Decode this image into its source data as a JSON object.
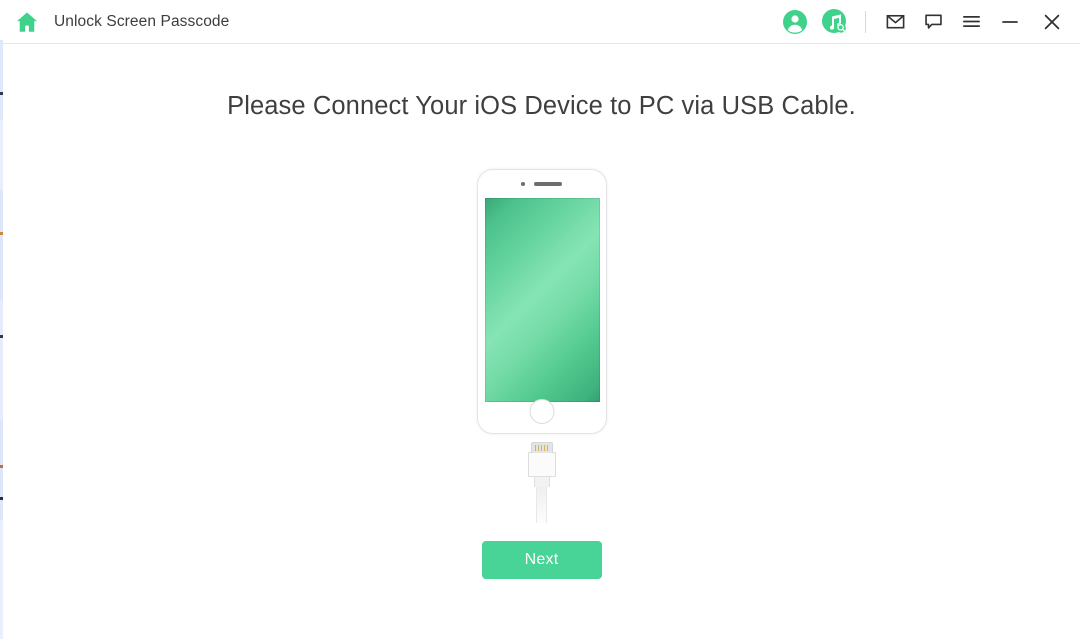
{
  "window": {
    "title": "Unlock Screen Passcode",
    "home_icon": "home-icon",
    "accent_color": "#48d397",
    "title_color": "#3d3d3d"
  },
  "titlebar_actions": [
    {
      "name": "account-icon",
      "label": "Account"
    },
    {
      "name": "music-search-icon",
      "label": "Music Search"
    },
    {
      "name": "mail-icon",
      "label": "Mail"
    },
    {
      "name": "chat-icon",
      "label": "Chat"
    },
    {
      "name": "menu-icon",
      "label": "Menu"
    },
    {
      "name": "minimize-icon",
      "label": "Minimize"
    },
    {
      "name": "close-icon",
      "label": "Close"
    }
  ],
  "main": {
    "headline": "Please Connect Your iOS Device to PC via USB Cable.",
    "illustration": {
      "device": "iphone-illustration",
      "screen_gradient_from": "#3aa776",
      "screen_gradient_to": "#86e4b4",
      "cable": "lightning-cable-illustration",
      "cable_pin_color": "#d9b44a"
    },
    "next_button": "Next"
  }
}
